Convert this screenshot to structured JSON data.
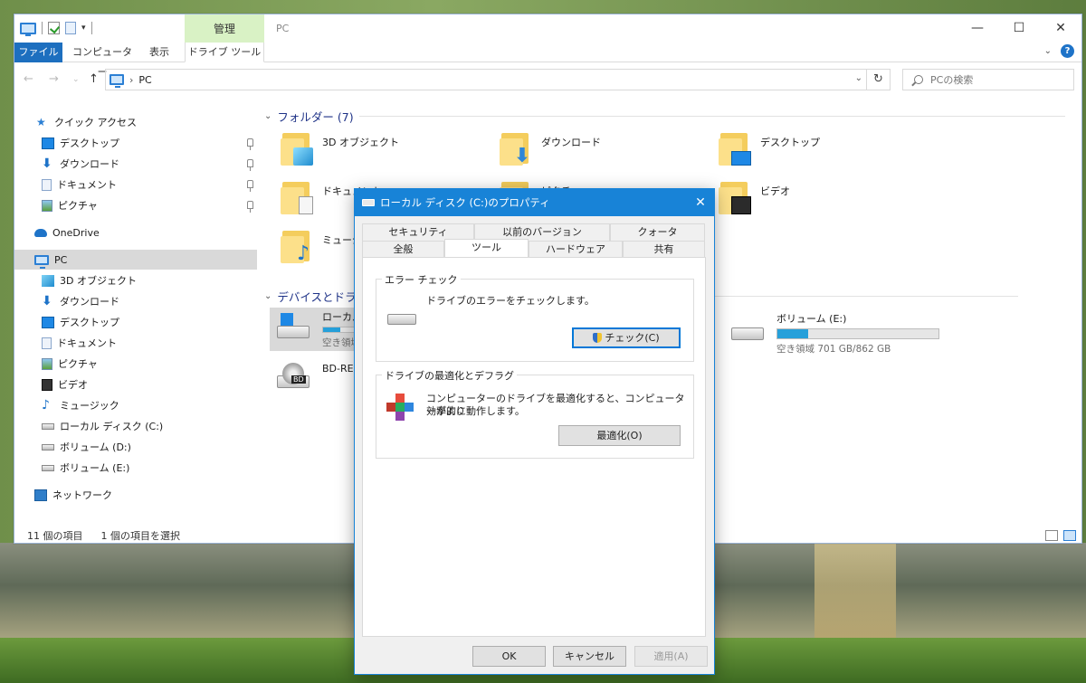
{
  "explorer": {
    "title": "PC",
    "context_tab_header": "管理",
    "ribbon_tabs": [
      "ファイル",
      "コンピューター",
      "表示",
      "ドライブ ツール"
    ],
    "address": {
      "crumb": "PC"
    },
    "search": {
      "placeholder": "PCの検索"
    },
    "nav": {
      "quick_access": "クイック アクセス",
      "quick_items": [
        "デスクトップ",
        "ダウンロード",
        "ドキュメント",
        "ピクチャ"
      ],
      "onedrive": "OneDrive",
      "pc": "PC",
      "pc_items": [
        "3D オブジェクト",
        "ダウンロード",
        "デスクトップ",
        "ドキュメント",
        "ピクチャ",
        "ビデオ",
        "ミュージック",
        "ローカル ディスク (C:)",
        "ボリューム (D:)",
        "ボリューム (E:)"
      ],
      "network": "ネットワーク"
    },
    "folders_header": "フォルダー (7)",
    "folders": [
      "3D オブジェクト",
      "ダウンロード",
      "デスクトップ",
      "ドキュメント",
      "ピクチャ",
      "ビデオ",
      "ミュージック"
    ],
    "devices_header": "デバイスとドライブ",
    "drives": [
      {
        "name": "ローカル",
        "free": "空き領域",
        "used_fraction": 0.5
      },
      {
        "name": "ボリューム (E:)",
        "free": "空き領域 701 GB/862 GB",
        "used_fraction": 0.19
      },
      {
        "name": "BD-RE",
        "badge": "BD"
      }
    ],
    "status": {
      "count": "11 個の項目",
      "selected": "1 個の項目を選択"
    }
  },
  "dialog": {
    "title": "ローカル ディスク (C:)のプロパティ",
    "tabs_row1": [
      "セキュリティ",
      "以前のバージョン",
      "クォータ"
    ],
    "tabs_row2": [
      "全般",
      "ツール",
      "ハードウェア",
      "共有"
    ],
    "error_check": {
      "title": "エラー チェック",
      "text": "ドライブのエラーをチェックします。",
      "button": "チェック(C)"
    },
    "optimize": {
      "title": "ドライブの最適化とデフラグ",
      "text_line1": "コンピューターのドライブを最適化すると、コンピューターがより",
      "text_line2": "効率的に動作します。",
      "button": "最適化(O)"
    },
    "buttons": {
      "ok": "OK",
      "cancel": "キャンセル",
      "apply": "適用(A)"
    }
  },
  "colors": {
    "accent": "#1883d7",
    "file_tab": "#1d6fbf",
    "context_tab": "#d9f2c5",
    "capacity_fill": "#26a0da"
  },
  "icons": [
    "pc-icon",
    "search-icon",
    "folder-icon",
    "drive-icon",
    "shield-icon",
    "defrag-icon",
    "close-icon"
  ]
}
